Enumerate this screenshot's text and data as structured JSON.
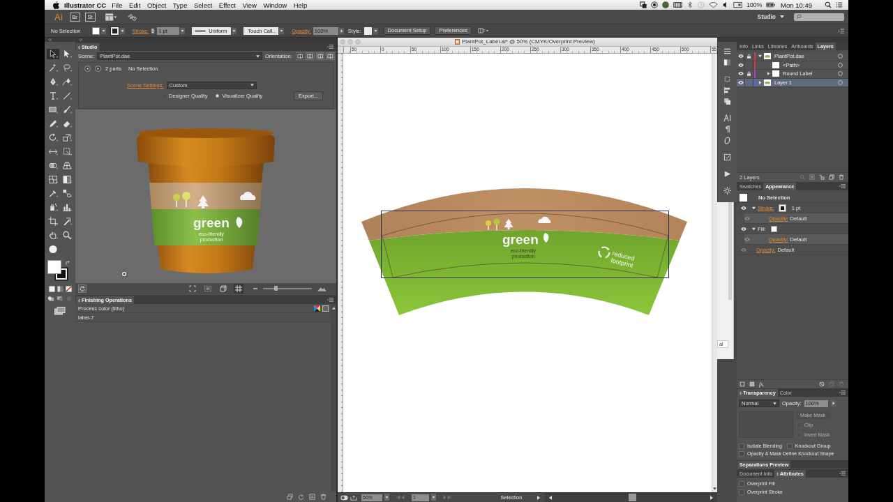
{
  "menubar": {
    "app_name": "Illustrator CC",
    "menus": [
      "File",
      "Edit",
      "Object",
      "Type",
      "Select",
      "Effect",
      "View",
      "Window",
      "Help"
    ],
    "battery": "100%",
    "clock": "Mon 10:49"
  },
  "app_bar": {
    "logo": "Ai",
    "bridge": "Br",
    "stock": "St",
    "workspace": "Studio"
  },
  "control_bar": {
    "selection": "No Selection",
    "stroke_label": "Stroke:",
    "stroke_weight": "1 pt",
    "stroke_profile": "Uniform",
    "brush": "Touch Call...",
    "opacity_label": "Opacity:",
    "opacity": "100%",
    "style_label": "Style:",
    "buttons": [
      "Document Setup",
      "Preferences"
    ]
  },
  "tools": [
    {
      "selected": true
    },
    {
      "selected": false
    },
    {
      "selected": false
    },
    {
      "selected": false
    },
    {
      "selected": false
    },
    {
      "selected": false
    },
    {
      "selected": false
    },
    {
      "selected": false
    },
    {
      "selected": false
    },
    {
      "selected": false
    },
    {
      "selected": false
    },
    {
      "selected": false
    },
    {
      "selected": false
    },
    {
      "selected": false
    },
    {
      "selected": false
    },
    {
      "selected": false
    },
    {
      "selected": false
    },
    {
      "selected": false
    },
    {
      "selected": false
    },
    {
      "selected": false
    },
    {
      "selected": false
    },
    {
      "selected": false
    },
    {
      "selected": false
    },
    {
      "selected": false
    },
    {
      "selected": false
    },
    {
      "selected": false
    },
    {
      "selected": false
    },
    {
      "selected": false
    },
    {
      "selected": false
    }
  ],
  "studio": {
    "tab": "Studio",
    "scene_label": "Scene:",
    "scene": "PlantPot.dae",
    "orientation_label": "Orientation:",
    "orientations": [
      {
        "selected": true
      },
      {
        "selected": false
      },
      {
        "selected": false
      },
      {
        "selected": false
      }
    ],
    "parts": "2 parts",
    "selection": "No Selection",
    "settings_label": "Scene Settings:",
    "settings": "Custom",
    "quality": [
      {
        "label": "Designer Quality",
        "selected": false
      },
      {
        "label": "Visualizer Quality",
        "selected": true
      }
    ],
    "export": "Export...",
    "pot_label": {
      "brand": "green",
      "tagline": [
        "eco-friendly",
        "production"
      ]
    },
    "grid_on": true,
    "zoom": {
      "level": 0.26
    }
  },
  "finishing_operations": {
    "tab": "Finishing Operations",
    "rows": [
      {
        "kind": "process",
        "label": "Process color (litho)"
      },
      {
        "kind": "item",
        "label": "label-7"
      }
    ]
  },
  "document": {
    "title": "PlantPot_Label.ai* @ 50% (CMYK/Overprint Preview)",
    "ruler": [
      "50",
      "0",
      "50",
      "100",
      "150",
      "200",
      "250",
      "300",
      "350",
      "400",
      "450",
      "500",
      "55"
    ],
    "artwork": {
      "brand": "green",
      "tagline": [
        "eco-friendly",
        "production"
      ],
      "badge": [
        "reduced",
        "footprint"
      ]
    },
    "zoom": "50%",
    "page": "1",
    "status": "Selection"
  },
  "background_window": {
    "fragment": "al"
  },
  "layers_panel": {
    "tabs": [
      {
        "label": "Info",
        "selected": false
      },
      {
        "label": "Links",
        "selected": false
      },
      {
        "label": "Libraries",
        "selected": false
      },
      {
        "label": "Artboards",
        "selected": false
      },
      {
        "label": "Layers",
        "selected": true
      }
    ],
    "layers": [
      {
        "kind": "layer",
        "name": "PlantPot.dae",
        "color": "#d8383c",
        "visible": true,
        "locked": true,
        "expanded": true,
        "selected": false,
        "children": [
          {
            "kind": "path",
            "name": "<Path>",
            "color": "#d8383c",
            "visible": true,
            "locked": false,
            "selected": false
          },
          {
            "kind": "group",
            "name": "Round Label",
            "color": "#b23fd0",
            "visible": true,
            "locked": true,
            "expanded": false,
            "selected": false
          }
        ]
      },
      {
        "kind": "layer",
        "name": "Layer 1",
        "color": "#4a6ee0",
        "visible": true,
        "locked": false,
        "expanded": false,
        "selected": true
      }
    ],
    "count": "2 Layers"
  },
  "appearance_panel": {
    "tabs": [
      {
        "label": "Swatches",
        "selected": false
      },
      {
        "label": "Appearance",
        "selected": true
      }
    ],
    "header": "No Selection",
    "items": [
      {
        "kind": "stroke",
        "label": "Stroke:",
        "value": "1 pt",
        "expanded": true,
        "children": [
          {
            "kind": "opacity",
            "label": "Opacity:",
            "value": "Default"
          }
        ]
      },
      {
        "kind": "fill",
        "label": "Fill:",
        "expanded": true,
        "children": [
          {
            "kind": "opacity",
            "label": "Opacity:",
            "value": "Default"
          }
        ]
      },
      {
        "kind": "opacity",
        "label": "Opacity:",
        "value": "Default"
      }
    ],
    "fx": "fx."
  },
  "transparency_panel": {
    "tabs": [
      {
        "label": "Transparency",
        "selected": true
      },
      {
        "label": "Color",
        "selected": false
      }
    ],
    "blend_mode": "Normal",
    "opacity_label": "Opacity:",
    "opacity": "100%",
    "make_mask": {
      "label": "Make Mask",
      "disabled": true
    },
    "mask_options": [
      {
        "label": "Clip",
        "checked": false,
        "disabled": true
      },
      {
        "label": "Invert Mask",
        "checked": false,
        "disabled": true
      }
    ],
    "options": [
      {
        "label": "Isolate Blending",
        "checked": false
      },
      {
        "label": "Knockout Group",
        "checked": false
      },
      {
        "label": "Opacity & Mask Define Knockout Shape",
        "checked": false
      }
    ]
  },
  "separations_panel": {
    "tab": "Separations Preview"
  },
  "attributes_panel": {
    "tabs": [
      {
        "label": "Document Info",
        "selected": false
      },
      {
        "label": "Attributes",
        "selected": true
      }
    ],
    "options": [
      {
        "label": "Overprint Fill",
        "checked": false
      },
      {
        "label": "Overprint Stroke",
        "checked": false
      }
    ]
  }
}
